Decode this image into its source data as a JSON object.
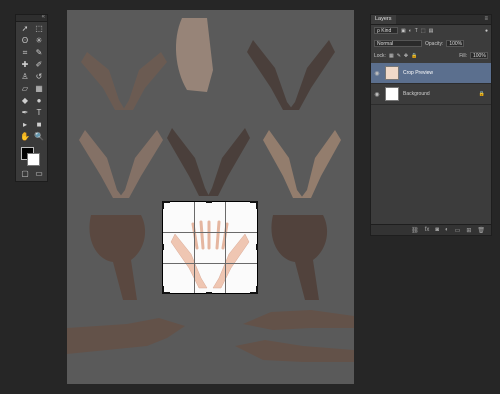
{
  "app": {
    "accent": "#4f6a8f"
  },
  "tools": {
    "collapse_glyph": "«",
    "items": [
      {
        "name": "move-tool-icon",
        "glyph": "➚"
      },
      {
        "name": "marquee-tool-icon",
        "glyph": "⬚"
      },
      {
        "name": "lasso-tool-icon",
        "glyph": "ʘ"
      },
      {
        "name": "magic-wand-icon",
        "glyph": "✳"
      },
      {
        "name": "crop-tool-icon",
        "glyph": "⌗"
      },
      {
        "name": "eyedropper-icon",
        "glyph": "✎"
      },
      {
        "name": "healing-brush-icon",
        "glyph": "✚"
      },
      {
        "name": "brush-tool-icon",
        "glyph": "✐"
      },
      {
        "name": "clone-stamp-icon",
        "glyph": "♙"
      },
      {
        "name": "history-brush-icon",
        "glyph": "↺"
      },
      {
        "name": "eraser-icon",
        "glyph": "▱"
      },
      {
        "name": "gradient-icon",
        "glyph": "▦"
      },
      {
        "name": "blur-tool-icon",
        "glyph": "◆"
      },
      {
        "name": "dodge-tool-icon",
        "glyph": "●"
      },
      {
        "name": "pen-tool-icon",
        "glyph": "✒"
      },
      {
        "name": "type-tool-icon",
        "glyph": "T"
      },
      {
        "name": "path-select-icon",
        "glyph": "▸"
      },
      {
        "name": "shape-tool-icon",
        "glyph": "■"
      },
      {
        "name": "hand-tool-icon",
        "glyph": "✋"
      },
      {
        "name": "zoom-tool-icon",
        "glyph": "🔍"
      }
    ],
    "foreground_color": "#000000",
    "background_color": "#ffffff"
  },
  "layers_panel": {
    "tab": "Layers",
    "menu_glyph": "≡",
    "filter_kind": "ρ Kind",
    "blend_mode": "Normal",
    "opacity_label": "Opacity:",
    "opacity_value": "100%",
    "lock_label": "Lock:",
    "fill_label": "Fill:",
    "fill_value": "100%",
    "layers": [
      {
        "name": "Crop Preview",
        "selected": true
      },
      {
        "name": "Background",
        "selected": false
      }
    ],
    "footer_icons": [
      "link-layers-icon",
      "fx-icon",
      "mask-icon",
      "adjustment-icon",
      "group-icon",
      "new-layer-icon",
      "trash-icon"
    ]
  }
}
